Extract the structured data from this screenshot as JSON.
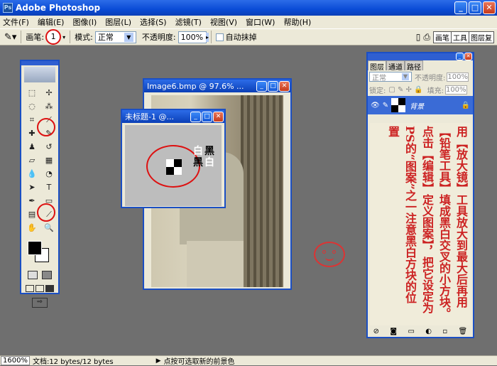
{
  "app": {
    "title": "Adobe Photoshop"
  },
  "menu": [
    "文件(F)",
    "编辑(E)",
    "图像(I)",
    "图层(L)",
    "选择(S)",
    "滤镜(T)",
    "视图(V)",
    "窗口(W)",
    "帮助(H)"
  ],
  "options": {
    "brush_label": "画笔:",
    "brush_size": "1",
    "mode_label": "模式:",
    "mode_value": "正常",
    "opacity_label": "不透明度:",
    "opacity_value": "100%",
    "auto_erase_label": "自动抹掉",
    "right_tabs": [
      "画笔",
      "工具",
      "图层复"
    ]
  },
  "doc_image6": {
    "title": "Image6.bmp @ 97.6% ..."
  },
  "doc_untitled": {
    "title": "未标题-1 @...",
    "label_white": "白",
    "label_black1": "黑",
    "label_black2": "黑",
    "label_white2": "白"
  },
  "layers": {
    "tabs": [
      "图层",
      "通道",
      "路径"
    ],
    "blend": "正常",
    "opacity_label": "不透明度:",
    "opacity_value": "100%",
    "lock_label": "锁定:",
    "fill_label": "填充:",
    "fill_value": "100%",
    "layer_name": "背景"
  },
  "instructions": {
    "columns": [
      "用【放大镜】工具放大到最大后再用",
      "【铅笔工具】填成黑白交叉的小方块。",
      "点击【编辑】定义图案】，把它设定为",
      "PS的“图案”之一注意黑白方块的位",
      "置"
    ]
  },
  "status": {
    "zoom": "1600%",
    "doc_info": "文档:12 bytes/12 bytes",
    "hint": "点按可选取新的前景色"
  },
  "colors": {
    "accent": "#0b3fb6",
    "annotation": "#cc2222"
  }
}
